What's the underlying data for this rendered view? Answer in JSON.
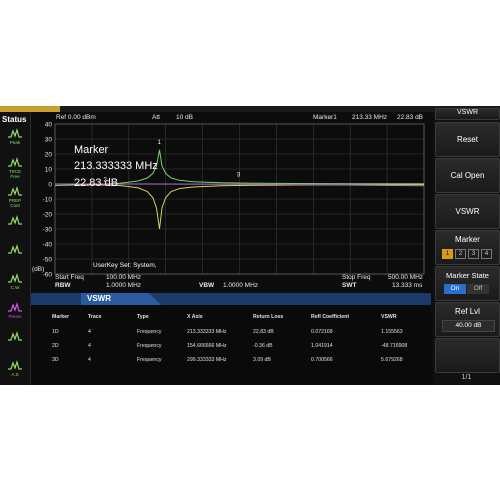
{
  "status": {
    "title": "Status",
    "icons": [
      {
        "icon": "peak-icon",
        "label": "Peak"
      },
      {
        "icon": "trace-free-icon",
        "label": "TRCE\nFree"
      },
      {
        "icon": "preamp-icon",
        "label": "PREP\nCont"
      },
      {
        "icon": "curve-icon",
        "label": ""
      },
      {
        "icon": "waveform-icon",
        "label": ""
      },
      {
        "icon": "cw-icon",
        "label": "C.W"
      },
      {
        "icon": "presm-icon",
        "label": "Presm"
      },
      {
        "icon": "wave-icon",
        "label": ""
      },
      {
        "icon": "asw-icon",
        "label": "A.S"
      }
    ]
  },
  "topbar": {
    "ref": "Ref  0.00 dBm",
    "att": "Att",
    "att_value": "10 dB",
    "marker_label": "Marker1",
    "marker_freq": "213.33 MHz",
    "marker_level": "22.83 dB"
  },
  "plot": {
    "y_ticks": [
      "40",
      "30",
      "20",
      "10",
      "0",
      "-10",
      "-20",
      "-30",
      "-40",
      "-50",
      "-60"
    ],
    "y_unit": "(dB)",
    "marker_title": "Marker",
    "marker_freq": "213.333333 MHz",
    "marker_level": "22.83 dB",
    "userkey": "UserKey Set:    System,",
    "marker_numbers": [
      "1",
      "2",
      "3"
    ],
    "colors": {
      "green": "#79d16b",
      "yellow": "#d2d65a",
      "purple": "#b070d8",
      "grid": "#3a3a3a"
    }
  },
  "chart_data": {
    "type": "line",
    "title": "",
    "xlabel": "",
    "ylabel": "(dB)",
    "xlim": [
      100,
      500
    ],
    "ylim": [
      -60,
      40
    ],
    "series": [
      {
        "name": "",
        "color": "#79d16b",
        "x": [
          100,
          140,
          170,
          190,
          200,
          206,
          210,
          213.3,
          216,
          220,
          226,
          235,
          250,
          280,
          320,
          380,
          440,
          500
        ],
        "y": [
          -1,
          -0.5,
          0.5,
          2,
          4,
          7,
          12,
          22.83,
          12,
          7,
          4,
          2.5,
          1.5,
          0.8,
          0.5,
          0.3,
          0.2,
          0.1
        ]
      },
      {
        "name": "",
        "color": "#d2d65a",
        "x": [
          100,
          140,
          170,
          190,
          200,
          206,
          210,
          213.3,
          216,
          220,
          226,
          235,
          250,
          280,
          320,
          380,
          440,
          500
        ],
        "y": [
          0,
          -0.5,
          -1,
          -2.5,
          -5,
          -9,
          -16,
          -30,
          -16,
          -9,
          -5,
          -3,
          -2,
          -1.2,
          -0.8,
          -0.6,
          -0.5,
          -0.4
        ]
      },
      {
        "name": "",
        "color": "#b070d8",
        "x": [
          100,
          200,
          300,
          400,
          500
        ],
        "y": [
          0,
          0,
          -0.2,
          -0.6,
          -1.2
        ]
      }
    ]
  },
  "bottom": {
    "start_label": "Start Freq",
    "start_value": "100.00 MHz",
    "rbw_label": "RBW",
    "rbw_value": "1.0000 MHz",
    "vbw_label": "VBW",
    "vbw_value": "1.0000 MHz",
    "stop_label": "Stop Freq",
    "stop_value": "500.00 MHz",
    "swt_label": "SWT",
    "swt_value": "13.333 ms"
  },
  "vswr": {
    "title": "VSWR",
    "headers": [
      "Marker",
      "Trace",
      "Type",
      "X Axis",
      "Return Loss",
      "Refl Coefficient",
      "VSWR"
    ],
    "rows": [
      [
        "1D",
        "4",
        "Frequency",
        "213.333333 MHz",
        "22.83 dB",
        "0.072168",
        "1.155563"
      ],
      [
        "2D",
        "4",
        "Frequency",
        "154.666666 MHz",
        "-0.36 dB",
        "1.041914",
        "-48.716908"
      ],
      [
        "3D",
        "4",
        "Frequency",
        "299.333333 MHz",
        "3.09 dB",
        "0.700566",
        "5.679268"
      ]
    ]
  },
  "softkeys": {
    "top_label": "VSWR",
    "reset": "Reset",
    "cal_open": "Cal Open",
    "vswr": "VSWR",
    "marker": "Marker",
    "marker_buttons": [
      "1",
      "2",
      "3",
      "4"
    ],
    "marker_state": "Marker State",
    "on": "On",
    "off": "Off",
    "ref_lvl": "Ref Lvl",
    "ref_lvl_value": "40.00 dB",
    "page": "1/1"
  }
}
